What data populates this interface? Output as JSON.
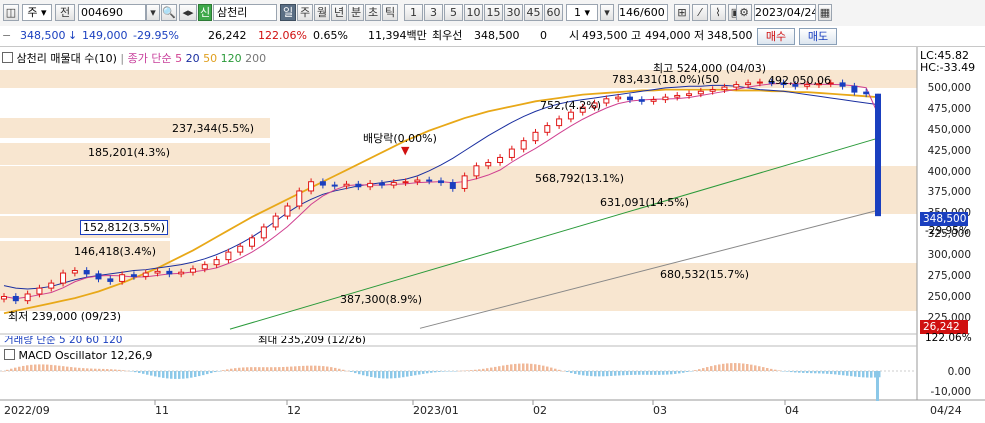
{
  "toolbar": {
    "market": "주",
    "prefix": "전",
    "code": "004690",
    "sin": "신",
    "name": "삼천리",
    "periods": [
      "일",
      "주",
      "월",
      "년",
      "분",
      "초",
      "틱"
    ],
    "active_period": "일",
    "intervals": [
      "1",
      "3",
      "5",
      "10",
      "15",
      "30",
      "45",
      "60"
    ],
    "interval_sel": "1",
    "count": "146/600",
    "date": "2023/04/24"
  },
  "quote": {
    "price": "348,500",
    "change_arrow": "↓",
    "change": "149,000",
    "change_pct": "-29.95%",
    "volume": "26,242",
    "volume_pct": "122.06%",
    "turnover_pct": "0.65%",
    "amount": "11,394백만",
    "best_label": "최우선",
    "best_price": "348,500",
    "best_qty": "0",
    "open_label": "시",
    "open": "493,500",
    "high_label": "고",
    "high": "494,000",
    "low_label": "저",
    "low": "348,500",
    "buy_label": "매수",
    "sell_label": "매도"
  },
  "legend": {
    "title": "삼천리 매물대 수(10)",
    "ma_label": "종가 단순",
    "ma_periods": [
      "5",
      "20",
      "50",
      "120",
      "200"
    ]
  },
  "lc_hc": {
    "lc": "LC:45.82",
    "hc": "HC:-33.49"
  },
  "price_tag": {
    "price": "348,500",
    "pct": "-29.95%"
  },
  "volume_tag": {
    "value": "26,242",
    "pct": "122.06%"
  },
  "volume_legend": "거래량 단순 5  20  60  120",
  "volume_max": "최대 235,209 (12/26)",
  "macd_legend": "MACD Oscillator 12,26,9",
  "annotations": {
    "high": "최고 524,000 (04/03)",
    "low": "최저 239,000 (09/23)",
    "dividend": "배당락(0.00%)",
    "bands": [
      {
        "label": "783,431(18.0%)(50",
        "value": "783,431",
        "pct": 18.0
      },
      {
        "label": "492,050,06",
        "value": "492,050",
        "pct": null
      },
      {
        "label": "237,344(5.5%)",
        "value": "237,344",
        "pct": 5.5
      },
      {
        "label": "185,201(4.3%)",
        "value": "185,201",
        "pct": 4.3
      },
      {
        "label": "568,792(13.1%)",
        "value": "568,792",
        "pct": 13.1
      },
      {
        "label": "631,091(14.5%)",
        "value": "631,091",
        "pct": 14.5
      },
      {
        "label": "152,812(3.5%)",
        "value": "152,812",
        "pct": 3.5
      },
      {
        "label": "146,418(3.4%)",
        "value": "146,418",
        "pct": 3.4
      },
      {
        "label": "680,532(15.7%)",
        "value": "680,532",
        "pct": 15.7
      },
      {
        "label": "387,300(8.9%)",
        "value": "387,300",
        "pct": 8.9
      },
      {
        "label": "752,(4.2%)",
        "value": "752",
        "pct": 4.2
      }
    ]
  },
  "chart_data": {
    "type": "candlestick",
    "y_ticks": [
      "500,000",
      "475,000",
      "450,000",
      "425,000",
      "400,000",
      "375,000",
      "350,000",
      "325,000",
      "300,000",
      "275,000",
      "250,000",
      "225,000"
    ],
    "y_tick_values": [
      500000,
      475000,
      450000,
      425000,
      400000,
      375000,
      350000,
      325000,
      300000,
      275000,
      250000,
      225000
    ],
    "ylim": [
      212000,
      520000
    ],
    "x_ticks": [
      "2022/09",
      "11",
      "12",
      "2023/01",
      "02",
      "03",
      "04",
      "04/24"
    ],
    "macd_ticks": [
      "0.00",
      "-10,000"
    ],
    "close_series": [
      252000,
      247000,
      255000,
      262000,
      268000,
      280000,
      283000,
      279000,
      273000,
      270000,
      278000,
      276000,
      280000,
      282000,
      279000,
      281000,
      285000,
      290000,
      296000,
      305000,
      312000,
      322000,
      335000,
      348000,
      360000,
      378000,
      389000,
      385000,
      384000,
      386000,
      383000,
      387000,
      385000,
      388000,
      389000,
      391000,
      390000,
      388000,
      381000,
      396000,
      408000,
      412000,
      418000,
      428000,
      438000,
      448000,
      456000,
      464000,
      472000,
      478000,
      483000,
      488000,
      490000,
      487000,
      485000,
      487000,
      490000,
      492000,
      494000,
      497000,
      499000,
      502000,
      505000,
      507000,
      508000,
      507000,
      505000,
      503000,
      505000,
      506000,
      507000,
      503000,
      496000,
      494000,
      348500
    ],
    "ma20": [
      265000,
      262000,
      261000,
      262000,
      264000,
      268000,
      272000,
      275000,
      277000,
      279000,
      281000,
      283000,
      284000,
      286000,
      288000,
      290000,
      293000,
      297000,
      302000,
      308000,
      315000,
      323000,
      332000,
      342000,
      352000,
      361000,
      368000,
      374000,
      378000,
      381000,
      384000,
      386000,
      388000,
      390000,
      392000,
      396000,
      402000,
      409000,
      417000,
      426000,
      435000,
      444000,
      452000,
      460000,
      467000,
      473000,
      478000,
      482000,
      485000,
      487000,
      489000,
      491000,
      493000,
      495000,
      497000,
      499000,
      501000,
      502000,
      503000,
      503000,
      504000,
      504000,
      503000,
      501000,
      499000,
      498000,
      497000,
      495000,
      493000,
      491000,
      489000,
      487000,
      485000,
      483000,
      481000
    ],
    "ma50": [
      232000,
      235000,
      238000,
      241000,
      244000,
      247000,
      250000,
      254000,
      258000,
      263000,
      268000,
      274000,
      280000,
      286000,
      293000,
      300000,
      307000,
      315000,
      323000,
      331000,
      339000,
      347000,
      354000,
      361000,
      368000,
      375000,
      382000,
      389000,
      396000,
      403000,
      410000,
      417000,
      424000,
      431000,
      438000,
      444000,
      450000,
      455000,
      460000,
      465000,
      469000,
      473000,
      476000,
      479000,
      482000,
      485000,
      487000,
      489000,
      491000,
      493000,
      494000,
      495000,
      496000,
      497000,
      498000,
      498000,
      499000,
      499000,
      499000,
      499000,
      499000,
      499000,
      498000,
      498000,
      498000,
      497000,
      497000,
      496000,
      496000,
      495000,
      494000,
      493000,
      492000,
      491000,
      490000
    ],
    "ma120_start": 213000,
    "ma120_end": 441000,
    "ma200_start": 214000,
    "ma200_end": 355000
  }
}
